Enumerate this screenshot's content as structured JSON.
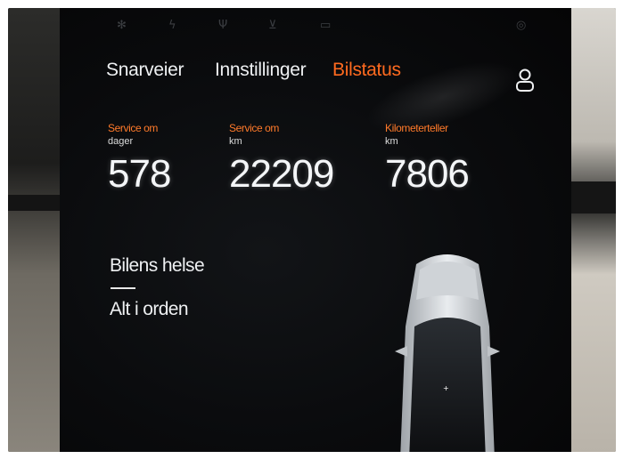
{
  "tabs": [
    {
      "label": "Snarveier",
      "active": false
    },
    {
      "label": "Innstillinger",
      "active": false
    },
    {
      "label": "Bilstatus",
      "active": true
    }
  ],
  "icons": {
    "profile": "user-profile-icon",
    "status_bar": [
      "fan-icon",
      "charge-icon",
      "food-icon",
      "cart-icon",
      "cafe-icon",
      "account-icon"
    ]
  },
  "metrics": [
    {
      "label": "Service om",
      "unit": "dager",
      "value": "578"
    },
    {
      "label": "Service om",
      "unit": "km",
      "value": "22209"
    },
    {
      "label": "Kilometerteller",
      "unit": "km",
      "value": "7806"
    }
  ],
  "health": {
    "title": "Bilens helse",
    "status": "Alt i orden"
  },
  "colors": {
    "accent": "#ff6a1f",
    "screen_bg": "#0a0b0d",
    "text": "#eef0f2"
  }
}
